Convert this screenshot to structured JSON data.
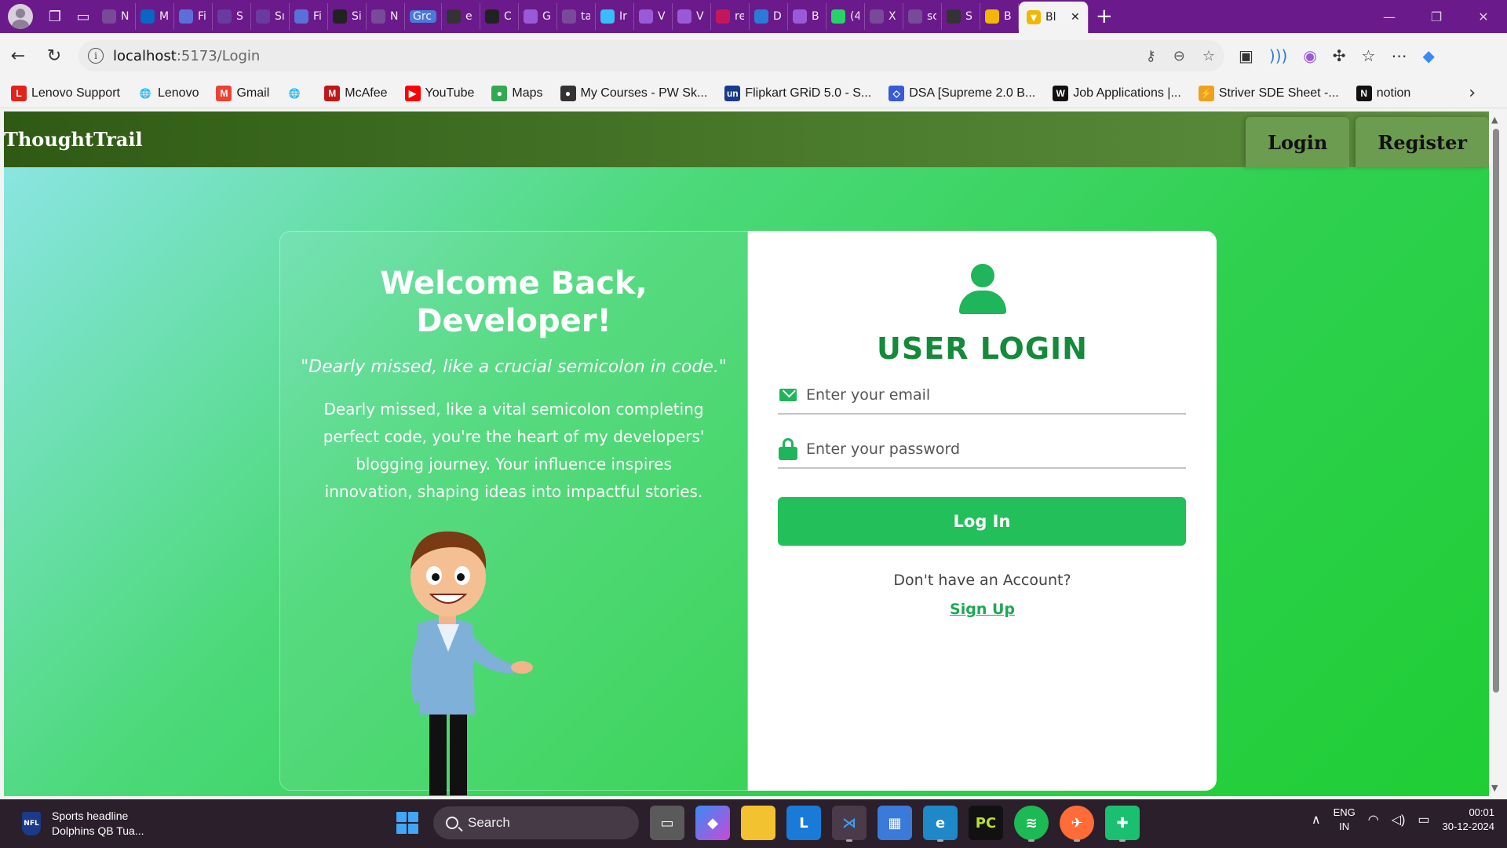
{
  "browser": {
    "tabs": [
      {
        "label": "N",
        "fav": "page-icon",
        "color": "#7a4a9a"
      },
      {
        "label": "M",
        "fav": "linkedin-icon",
        "color": "#0a66c2"
      },
      {
        "label": "Fi",
        "fav": "doc-icon",
        "color": "#5b6fd8"
      },
      {
        "label": "S",
        "fav": "list-icon",
        "color": "#6a3aa0"
      },
      {
        "label": "Sı",
        "fav": "list-icon",
        "color": "#6a3aa0"
      },
      {
        "label": "Fi",
        "fav": "doc-icon",
        "color": "#5b6fd8"
      },
      {
        "label": "Si",
        "fav": "github-icon",
        "color": "#222222"
      },
      {
        "label": "N",
        "fav": "page-icon",
        "color": "#7a4a9a"
      },
      {
        "label": "Grc",
        "fav": "",
        "color": "#4a7ad8"
      },
      {
        "label": "e",
        "fav": "dots-icon",
        "color": "#333333"
      },
      {
        "label": "C",
        "fav": "openai-icon",
        "color": "#222222"
      },
      {
        "label": "G",
        "fav": "vite-icon",
        "color": "#9a5ad8"
      },
      {
        "label": "ta",
        "fav": "search-icon",
        "color": "#7a4a9a"
      },
      {
        "label": "Ir",
        "fav": "tailwind-icon",
        "color": "#38bdf8"
      },
      {
        "label": "V",
        "fav": "vite-icon",
        "color": "#9a5ad8"
      },
      {
        "label": "V",
        "fav": "vite-icon",
        "color": "#9a5ad8"
      },
      {
        "label": "re",
        "fav": "n-icon",
        "color": "#c2185b"
      },
      {
        "label": "D",
        "fav": "edge-icon",
        "color": "#2a7ad8"
      },
      {
        "label": "B",
        "fav": "vite-icon",
        "color": "#9a5ad8"
      },
      {
        "label": "(4",
        "fav": "whatsapp-icon",
        "color": "#25d366"
      },
      {
        "label": "X",
        "fav": "search-icon",
        "color": "#7a4a9a"
      },
      {
        "label": "sc",
        "fav": "search-icon",
        "color": "#7a4a9a"
      },
      {
        "label": "S",
        "fav": "dots-icon",
        "color": "#333333"
      },
      {
        "label": "B",
        "fav": "vite-icon",
        "color": "#f2b705"
      }
    ],
    "active_tab": {
      "label": "Bl",
      "close": "✕"
    },
    "new_tab": "+",
    "address": {
      "host": "localhost",
      "path": ":5173/Login",
      "info": "i"
    },
    "bookmarks": [
      {
        "label": "Lenovo Support",
        "icon": "L",
        "color": "#e2231a"
      },
      {
        "label": "Lenovo",
        "icon": "🌐",
        "color": "transparent"
      },
      {
        "label": "Gmail",
        "icon": "M",
        "color": "#ea4335"
      },
      {
        "label": "",
        "icon": "🌐",
        "color": "transparent"
      },
      {
        "label": "McAfee",
        "icon": "M",
        "color": "#c01818"
      },
      {
        "label": "YouTube",
        "icon": "▶",
        "color": "#ff0000"
      },
      {
        "label": "Maps",
        "icon": "●",
        "color": "#34a853"
      },
      {
        "label": "My Courses - PW Sk...",
        "icon": "●",
        "color": "#333333"
      },
      {
        "label": "Flipkart GRiD 5.0 - S...",
        "icon": "un",
        "color": "#1a3a8a"
      },
      {
        "label": "DSA [Supreme 2.0 B...",
        "icon": "◇",
        "color": "#3a5ad8"
      },
      {
        "label": "Job Applications |...",
        "icon": "W",
        "color": "#111111"
      },
      {
        "label": "Striver SDE Sheet -...",
        "icon": "⚡",
        "color": "#f0a020"
      },
      {
        "label": "notion",
        "icon": "N",
        "color": "#111111"
      }
    ]
  },
  "app": {
    "brand": "ThoughtTrail",
    "nav": {
      "login": "Login",
      "register": "Register"
    },
    "welcome": "Welcome Back, Developer!",
    "quote": "\"Dearly missed, like a crucial semicolon in code.\"",
    "description": "Dearly missed, like a vital semicolon completing perfect code, you're the heart of my developers' blogging journey. Your influence inspires innovation, shaping ideas into impactful stories.",
    "form": {
      "title": "USER LOGIN",
      "email_placeholder": "Enter your email",
      "password_placeholder": "Enter your password",
      "submit": "Log In",
      "no_account": "Don't have an Account?",
      "signup": "Sign Up"
    },
    "colors": {
      "accent": "#22bf5a",
      "title": "#148a3a",
      "nav": "#3f6a22"
    }
  },
  "taskbar": {
    "news_title": "Sports headline",
    "news_sub": "Dolphins QB Tua...",
    "search": "Search",
    "lang_top": "ENG",
    "lang_bottom": "IN",
    "time": "00:01",
    "date": "30-12-2024"
  }
}
